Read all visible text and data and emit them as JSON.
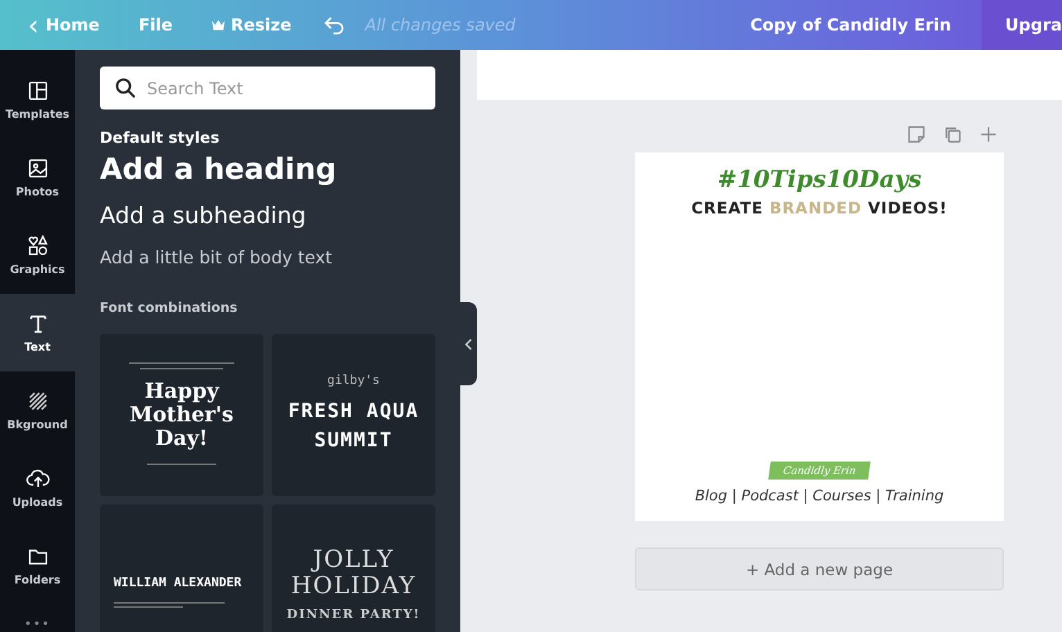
{
  "top_bar": {
    "home": "Home",
    "back_icon": "‹",
    "menu": [
      "File"
    ],
    "resize": "Resize",
    "status": "All changes saved",
    "document_title": "Copy of Candidly Erin",
    "upgrade": "Upgra"
  },
  "sidebar": {
    "items": [
      {
        "label": "Templates",
        "kind": "templates",
        "selected": false
      },
      {
        "label": "Photos",
        "kind": "photos",
        "selected": false
      },
      {
        "label": "Graphics",
        "kind": "graphics",
        "selected": false
      },
      {
        "label": "Text",
        "kind": "text",
        "selected": true
      },
      {
        "label": "Bkground",
        "kind": "background",
        "selected": false
      },
      {
        "label": "Uploads",
        "kind": "uploads",
        "selected": false
      },
      {
        "label": "Folders",
        "kind": "folders",
        "selected": false
      }
    ],
    "more": "•••"
  },
  "text_panel": {
    "search": {
      "placeholder": "Search Text"
    },
    "default_styles": "Default styles",
    "heading": "Add a heading",
    "subheading": "Add a subheading",
    "body": "Add a little bit of body text",
    "font_combinations": "Font combinations",
    "combos": [
      {
        "kind": "mothers",
        "lines": [
          "Happy",
          "Mother's",
          "Day!"
        ]
      },
      {
        "kind": "aqua",
        "small": "gilby's",
        "lines": [
          "FRESH AQUA",
          "SUMMIT"
        ]
      },
      {
        "kind": "william",
        "lines": [
          "WILLIAM ALEXANDER"
        ]
      },
      {
        "kind": "jolly",
        "lines": [
          "JOLLY",
          "HOLIDAY"
        ],
        "small": "DINNER PARTY!"
      }
    ]
  },
  "canvas": {
    "page": {
      "hashtag": "#10Tips10Days",
      "headline": [
        "CREATE",
        "BRANDED",
        "VIDEOS!"
      ],
      "brand": "Candidly Erin",
      "links": "Blog | Podcast | Courses | Training"
    },
    "add_page": "+ Add a new page"
  }
}
